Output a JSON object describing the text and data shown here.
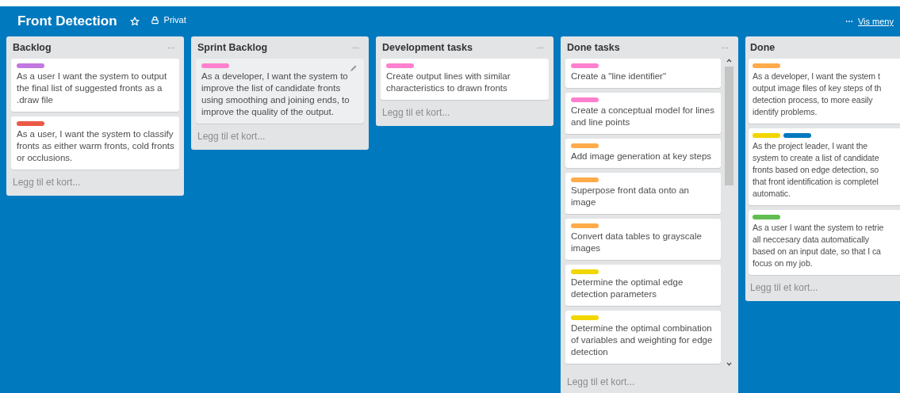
{
  "board": {
    "title": "Front Detection",
    "starred": false,
    "visibility": "Privat",
    "menu_link": "Vis meny"
  },
  "lists": [
    {
      "title": "Backlog",
      "scrollable": false,
      "cards": [
        {
          "labels": [
            {
              "color": "#c377e0"
            }
          ],
          "text": "As a user I want the system to output the final list of suggested fronts as a .draw file",
          "hovered": false
        },
        {
          "labels": [
            {
              "color": "#eb5a46"
            }
          ],
          "text": "As a user, I want the system to classify fronts as either warm fronts, cold fronts or occlusions.",
          "hovered": false
        }
      ],
      "add_card": "Legg til et kort..."
    },
    {
      "title": "Sprint Backlog",
      "scrollable": false,
      "cards": [
        {
          "labels": [
            {
              "color": "#ff80ce"
            }
          ],
          "text": "As a developer, I want the system to improve the list of candidate fronts using smoothing and joining ends, to improve the quality of the output.",
          "hovered": true
        }
      ],
      "add_card": "Legg til et kort..."
    },
    {
      "title": "Development tasks",
      "scrollable": false,
      "cards": [
        {
          "labels": [
            {
              "color": "#ff80ce"
            }
          ],
          "text": "Create output lines with similar characteristics to drawn fronts",
          "hovered": false
        }
      ],
      "add_card": "Legg til et kort..."
    },
    {
      "title": "Done tasks",
      "scrollable": true,
      "cards": [
        {
          "labels": [
            {
              "color": "#ff80ce"
            }
          ],
          "text": "Create a \"line identifier\"",
          "hovered": false
        },
        {
          "labels": [
            {
              "color": "#ff80ce"
            }
          ],
          "text": "Create a conceptual model for lines and line points",
          "hovered": false
        },
        {
          "labels": [
            {
              "color": "#ffab4a"
            }
          ],
          "text": "Add image generation at key steps",
          "hovered": false
        },
        {
          "labels": [
            {
              "color": "#ffab4a"
            }
          ],
          "text": "Superpose front data onto an image",
          "hovered": false
        },
        {
          "labels": [
            {
              "color": "#ffab4a"
            }
          ],
          "text": "Convert data tables to grayscale images",
          "hovered": false
        },
        {
          "labels": [
            {
              "color": "#f2d600"
            }
          ],
          "text": "Determine the optimal edge detection parameters",
          "hovered": false
        },
        {
          "labels": [
            {
              "color": "#f2d600"
            }
          ],
          "text": "Determine the optimal combination of variables and weighting for edge detection",
          "hovered": false
        }
      ],
      "add_card": "Legg til et kort..."
    },
    {
      "title": "Done",
      "scrollable": false,
      "cards": [
        {
          "labels": [
            {
              "color": "#ffab4a"
            }
          ],
          "text": "As a developer, I want the system t\noutput image files of key steps of th\ndetection process, to more easily\nidentify problems.",
          "hovered": false
        },
        {
          "labels": [
            {
              "color": "#f2d600"
            },
            {
              "color": "#0079bf"
            }
          ],
          "text": "As the project leader, I want the\nsystem to create a list of candidate\nfronts based on edge detection, so\nthat front identification is completel\nautomatic.",
          "hovered": false
        },
        {
          "labels": [
            {
              "color": "#61bd4f"
            }
          ],
          "text": "As a user I want the system to retrie\nall neccesary data automatically\nbased on an input date, so that I ca\nfocus on my job.",
          "hovered": false
        }
      ],
      "add_card": "Legg til et kort..."
    }
  ]
}
